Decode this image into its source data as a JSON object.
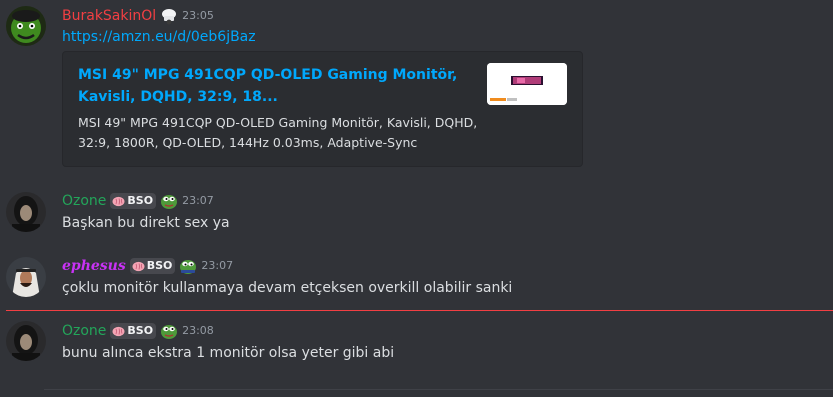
{
  "messages": [
    {
      "author": "BurakSakinOl",
      "author_color": "#f23f43",
      "time": "23:05",
      "link": "https://amzn.eu/d/0eb6jBaz",
      "embed": {
        "title": "MSI 49\" MPG 491CQP QD-OLED Gaming Monitör, Kavisli, DQHD, 32:9, 18...",
        "description": "MSI 49\" MPG 491CQP QD-OLED Gaming Monitör, Kavisli, DQHD, 32:9, 1800R, QD-OLED, 144Hz 0.03ms, Adaptive-Sync"
      }
    },
    {
      "author": "Ozone",
      "author_color": "#23a55a",
      "tag": "BSO",
      "time": "23:07",
      "text": "Başkan bu direkt sex ya"
    },
    {
      "author": "ephesus",
      "author_color": "#c832f5",
      "tag": "BSO",
      "time": "23:07",
      "text": "çoklu monitör kullanmaya devam etçeksen overkill olabilir sanki"
    },
    {
      "author": "Ozone",
      "author_color": "#23a55a",
      "tag": "BSO",
      "time": "23:08",
      "text": "bunu alınca ekstra 1 monitör olsa yeter gibi abi"
    }
  ],
  "icons": {
    "author_decoration_1": "chef-hat-icon",
    "tag_icon": "brain-icon",
    "author_decoration_2": "pepe-frog-icon"
  },
  "colors": {
    "background": "#313338",
    "embed_bg": "#2b2d31",
    "link": "#00a8fc",
    "new_messages_divider": "#f23f43"
  }
}
